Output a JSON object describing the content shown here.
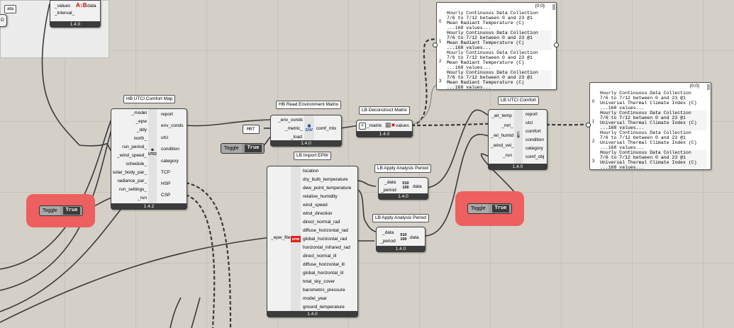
{
  "canvas": {
    "background": "#d4d0c8",
    "group_background": "#ececec",
    "toggle_highlight": "#ee5f5f"
  },
  "top_left": {
    "input_stub": "D",
    "tag": "ata",
    "values_comp": {
      "inputs": [
        "_values",
        "_interval_"
      ],
      "output": "data",
      "version": "1.4.0",
      "icon": "ab-icon"
    }
  },
  "utci_map": {
    "title": "HB UTCI Comfort Map",
    "inputs": [
      "_model",
      "_epw",
      "_ddy",
      "north_",
      "run_period_",
      "_wind_speed_",
      "schedule_",
      "solar_body_par_",
      "radiance_par_",
      "run_settings_",
      "_run"
    ],
    "outputs": [
      "report",
      "env_conds",
      "utci",
      "condition",
      "category",
      "TCP",
      "HSP",
      "CSP"
    ],
    "icon_text": "UTCI",
    "version": "1.4.2"
  },
  "toggle_left": {
    "label": "Toggle",
    "value": "True"
  },
  "read_env": {
    "title": "HB Read Environment Matrix",
    "inputs": [
      "_env_conds",
      "_metric_",
      "_load"
    ],
    "output": "comf_mtx",
    "icon_text": "ENV",
    "version": "1.4.0"
  },
  "mrt_panel": {
    "text": "MRT"
  },
  "toggle_mid": {
    "label": "Toggle",
    "value": "True"
  },
  "deconstruct": {
    "title": "LB Deconstruct Matrix",
    "input": "_matrix",
    "output": "values",
    "version": "1.4.0"
  },
  "import_epw": {
    "title": "LB Import EPW",
    "input": "_epw_file",
    "icon_text": "EPW",
    "outputs": [
      "location",
      "dry_bulb_temperature",
      "dew_point_temperature",
      "relative_humidity",
      "wind_speed",
      "wind_direction",
      "direct_normal_rad",
      "diffuse_horizontal_rad",
      "global_horizontal_rad",
      "horizontal_infrared_rad",
      "direct_normal_ill",
      "diffuse_horizontal_ill",
      "global_horizontal_ill",
      "total_sky_cover",
      "barometric_pressure",
      "model_year",
      "ground_temperature"
    ],
    "version": "1.4.0"
  },
  "period1": {
    "title": "LB Apply Analysis Period",
    "inputs": [
      "_data",
      "_period"
    ],
    "output": "data",
    "icon_text": "010 100",
    "version": "1.4.0"
  },
  "period2": {
    "title": "LB Apply Analysis Period",
    "inputs": [
      "_data",
      "_period"
    ],
    "output": "data",
    "icon_text": "010 100",
    "version": "1.4.0"
  },
  "utci_comfort": {
    "title": "LB UTCI Comfort",
    "inputs": [
      "_air_temp",
      "_mrt_",
      "_rel_humid",
      "_wind_vel_",
      "_run"
    ],
    "outputs": [
      "report",
      "utci",
      "comfort",
      "condition",
      "category",
      "comf_obj"
    ],
    "version": "1.4.0"
  },
  "toggle_right": {
    "label": "Toggle",
    "value": "True"
  },
  "panel_mrt": {
    "header": "{0;0}",
    "entries": [
      {
        "index": "0",
        "lines": [
          "Hourly Continuous Data Collection",
          "7/6 to 7/12 between 0 and 23 @1",
          "Mean Radiant Temperature (C)",
          "...168 values..."
        ]
      },
      {
        "index": "1",
        "lines": [
          "Hourly Continuous Data Collection",
          "7/6 to 7/12 between 0 and 23 @1",
          "Mean Radiant Temperature (C)",
          "...168 values..."
        ]
      },
      {
        "index": "2",
        "lines": [
          "Hourly Continuous Data Collection",
          "7/6 to 7/12 between 0 and 23 @1",
          "Mean Radiant Temperature (C)",
          "...168 values..."
        ]
      },
      {
        "index": "3",
        "lines": [
          "Hourly Continuous Data Collection",
          "7/6 to 7/12 between 0 and 23 @1",
          "Mean Radiant Temperature (C)",
          "...168 values..."
        ]
      }
    ]
  },
  "panel_utci": {
    "header": "{0;0}",
    "entries": [
      {
        "index": "0",
        "lines": [
          "Hourly Continuous Data Collection",
          "7/6 to 7/12 between 0 and 23 @1",
          "Universal Thermal Climate Index (C)",
          "...168 values..."
        ]
      },
      {
        "index": "1",
        "lines": [
          "Hourly Continuous Data Collection",
          "7/6 to 7/12 between 0 and 23 @1",
          "Universal Thermal Climate Index (C)",
          "...168 values..."
        ]
      },
      {
        "index": "2",
        "lines": [
          "Hourly Continuous Data Collection",
          "7/6 to 7/12 between 0 and 23 @1",
          "Universal Thermal Climate Index (C)",
          "...168 values..."
        ]
      },
      {
        "index": "3",
        "lines": [
          "Hourly Continuous Data Collection",
          "7/6 to 7/12 between 0 and 23 @1",
          "Universal Thermal Climate Index (C)",
          "...168 values..."
        ]
      }
    ]
  }
}
